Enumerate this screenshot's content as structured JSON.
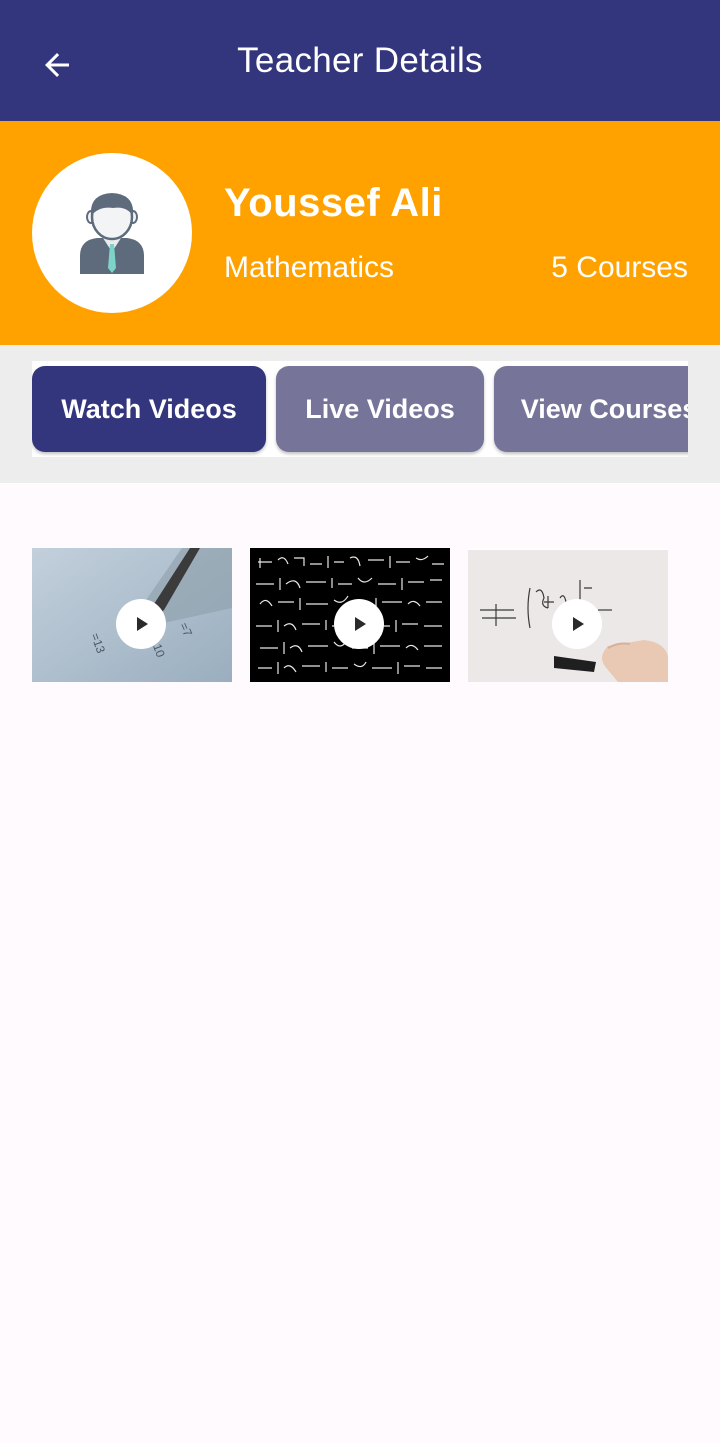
{
  "app_bar": {
    "title": "Teacher Details",
    "back_icon": "arrow-left-icon",
    "background_color": "#33367c"
  },
  "profile": {
    "name": "Youssef Ali",
    "subject": "Mathematics",
    "courses": "5 Courses",
    "avatar_icon": "teacher-avatar-icon",
    "background_color": "#ffa200"
  },
  "tabs": [
    {
      "label": "Watch Videos",
      "active": true
    },
    {
      "label": "Live Videos",
      "active": false
    },
    {
      "label": "View Courses",
      "active": false
    }
  ],
  "videos": [
    {
      "thumbnail": "pencil-math-thumbnail",
      "play_icon": "play-icon"
    },
    {
      "thumbnail": "equations-chalkboard-thumbnail",
      "play_icon": "play-icon"
    },
    {
      "thumbnail": "whiteboard-writing-thumbnail",
      "play_icon": "play-icon"
    }
  ],
  "colors": {
    "primary": "#33367c",
    "accent": "#ffa200",
    "tab_inactive": "#767599"
  }
}
